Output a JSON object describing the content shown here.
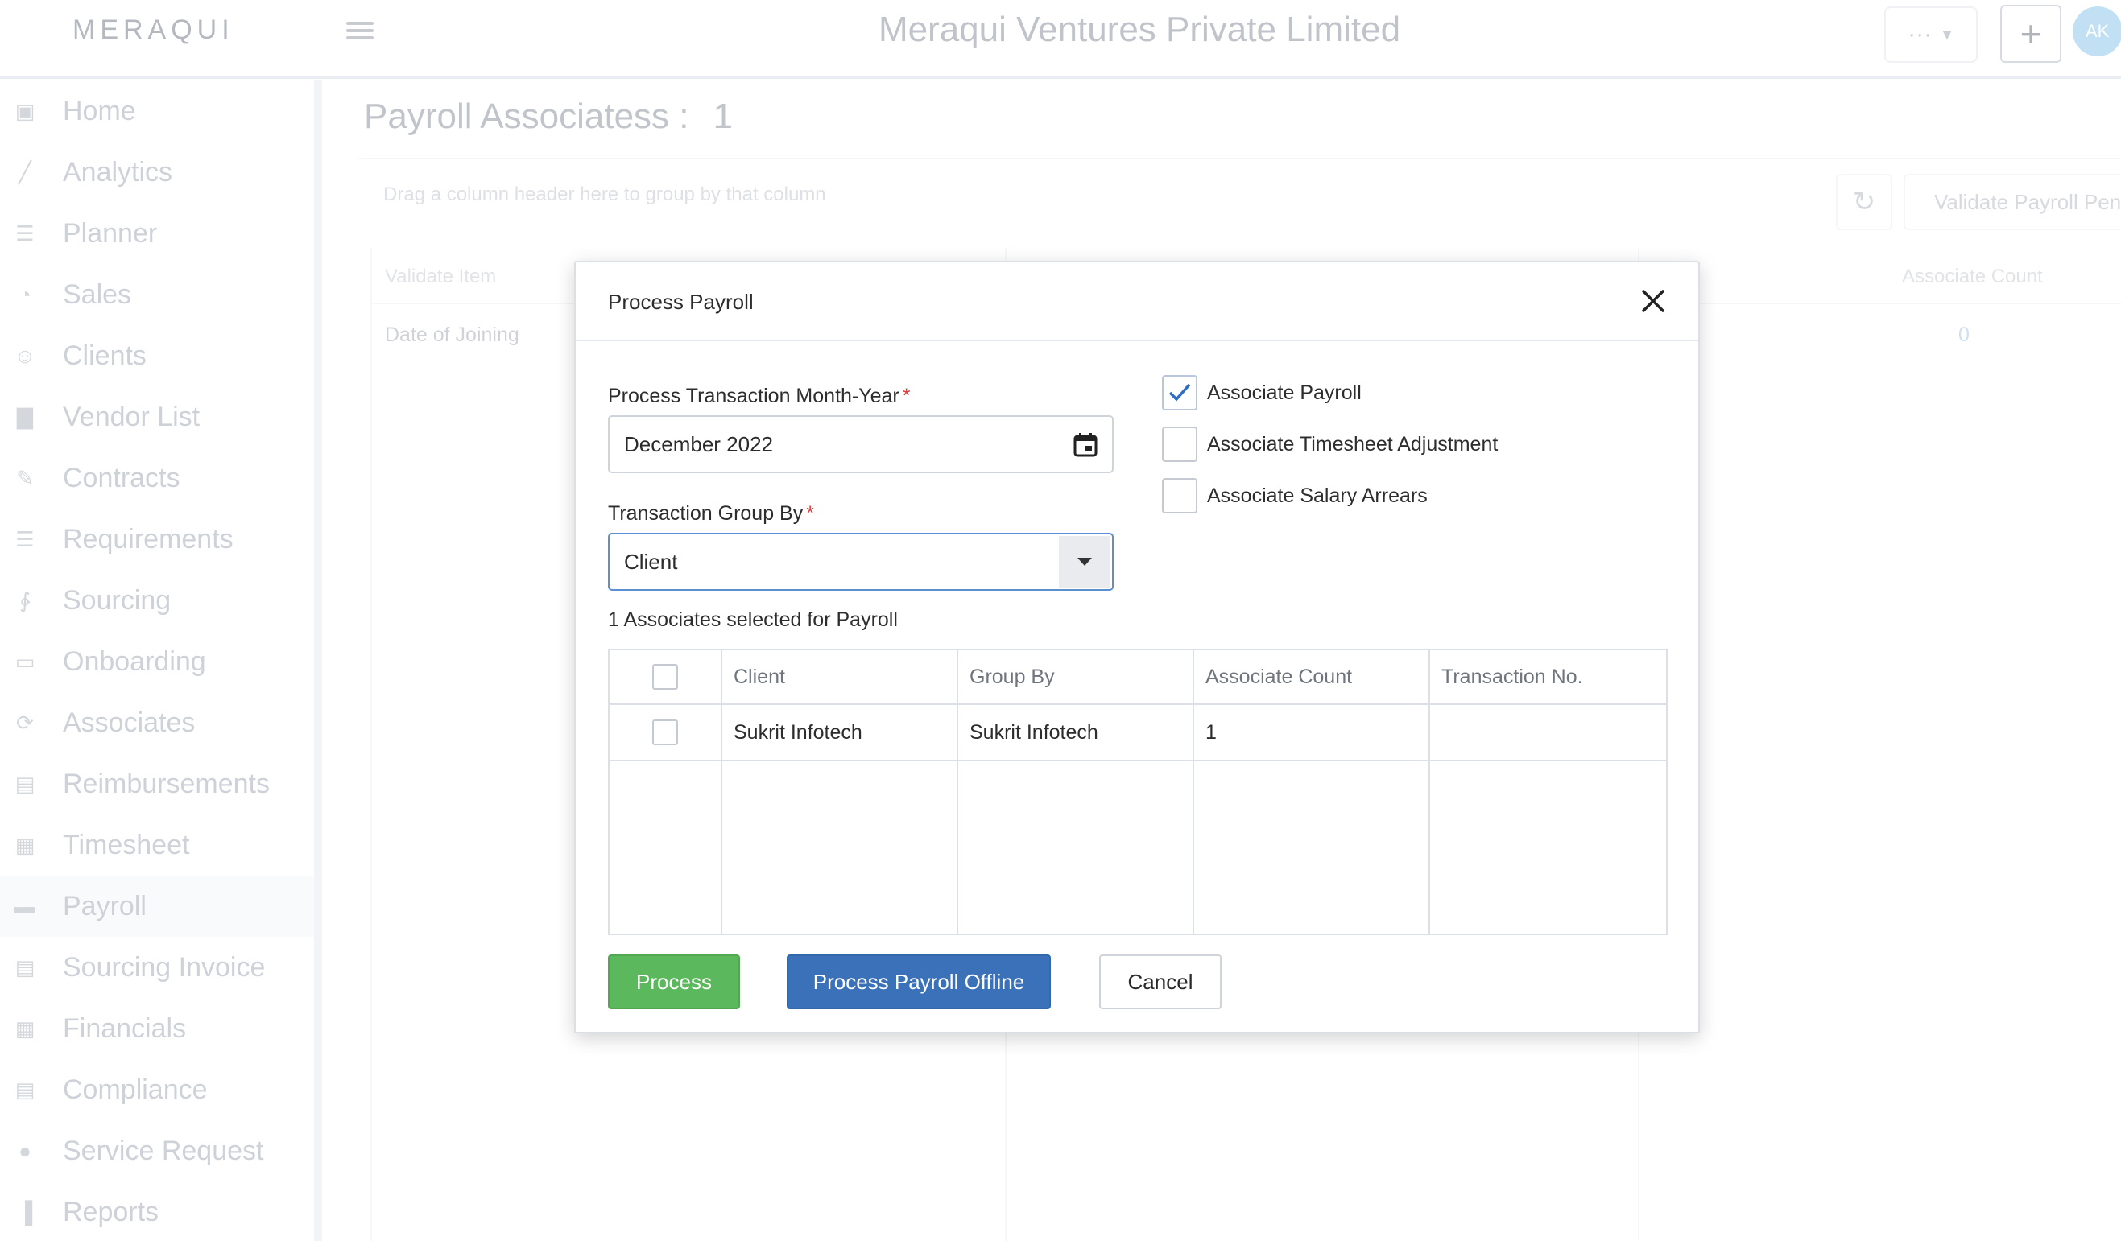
{
  "app": {
    "logo_text": "MERAQUI",
    "company_name": "Meraqui Ventures Private Limited",
    "more_label": "···",
    "add_label": "+",
    "avatar_initials": "AK"
  },
  "sidebar": {
    "items": [
      {
        "label": "Home",
        "icon": "home-icon"
      },
      {
        "label": "Analytics",
        "icon": "analytics-icon"
      },
      {
        "label": "Planner",
        "icon": "planner-icon"
      },
      {
        "label": "Sales",
        "icon": "sales-icon"
      },
      {
        "label": "Clients",
        "icon": "clients-icon"
      },
      {
        "label": "Vendor List",
        "icon": "vendor-icon"
      },
      {
        "label": "Contracts",
        "icon": "contracts-icon"
      },
      {
        "label": "Requirements",
        "icon": "requirements-icon"
      },
      {
        "label": "Sourcing",
        "icon": "sourcing-icon"
      },
      {
        "label": "Onboarding",
        "icon": "onboarding-icon"
      },
      {
        "label": "Associates",
        "icon": "associates-icon"
      },
      {
        "label": "Reimbursements",
        "icon": "reimbursements-icon"
      },
      {
        "label": "Timesheet",
        "icon": "timesheet-icon"
      },
      {
        "label": "Payroll",
        "icon": "payroll-icon",
        "active": true
      },
      {
        "label": "Sourcing Invoice",
        "icon": "invoice-icon"
      },
      {
        "label": "Financials",
        "icon": "financials-icon"
      },
      {
        "label": "Compliance",
        "icon": "compliance-icon"
      },
      {
        "label": "Service Request",
        "icon": "service-request-icon"
      },
      {
        "label": "Reports",
        "icon": "reports-icon"
      }
    ]
  },
  "page": {
    "title": "Payroll Associatess :",
    "count": "1",
    "group_hint": "Drag a column header here to group by that column",
    "validate_button": "Validate Payroll Pend",
    "table": {
      "header_left": "Validate Item",
      "header_right": "Associate Count",
      "row_left": "Date of Joining",
      "row_right": "0"
    }
  },
  "modal": {
    "title": "Process Payroll",
    "month_label": "Process Transaction Month-Year",
    "month_value": "December 2022",
    "group_label": "Transaction Group By",
    "group_value": "Client",
    "required_mark": "*",
    "checkboxes": [
      {
        "label": "Associate Payroll",
        "checked": true
      },
      {
        "label": "Associate Timesheet Adjustment",
        "checked": false
      },
      {
        "label": "Associate Salary Arrears",
        "checked": false
      }
    ],
    "selected_note": "1 Associates selected for Payroll",
    "grid": {
      "columns": [
        "Client",
        "Group By",
        "Associate Count",
        "Transaction No."
      ],
      "rows": [
        {
          "client": "Sukrit Infotech",
          "group_by": "Sukrit Infotech",
          "associate_count": "1",
          "transaction_no": ""
        }
      ]
    },
    "buttons": {
      "process": "Process",
      "offline": "Process Payroll Offline",
      "cancel": "Cancel"
    }
  },
  "colors": {
    "process_green": "#5cb85c",
    "offline_blue": "#3a71b8",
    "required_red": "#e23b3b",
    "check_blue": "#2f6dc4"
  }
}
